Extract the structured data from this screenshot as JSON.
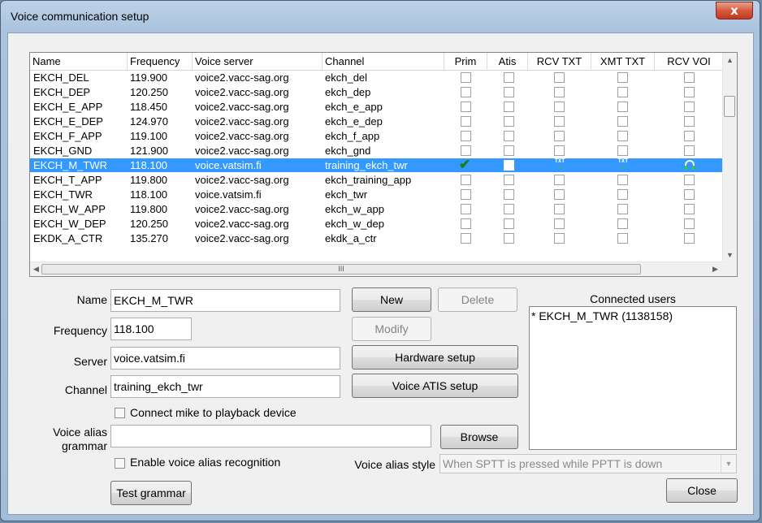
{
  "window": {
    "title": "Voice communication setup",
    "close_glyph": "x"
  },
  "grid": {
    "columns": [
      "Name",
      "Frequency",
      "Voice server",
      "Channel",
      "Prim",
      "Atis",
      "RCV TXT",
      "XMT TXT",
      "RCV VOI"
    ],
    "rows": [
      {
        "name": "EKCH_DEL",
        "freq": "119.900",
        "server": "voice2.vacc-sag.org",
        "channel": "ekch_del"
      },
      {
        "name": "EKCH_DEP",
        "freq": "120.250",
        "server": "voice2.vacc-sag.org",
        "channel": "ekch_dep"
      },
      {
        "name": "EKCH_E_APP",
        "freq": "118.450",
        "server": "voice2.vacc-sag.org",
        "channel": "ekch_e_app"
      },
      {
        "name": "EKCH_E_DEP",
        "freq": "124.970",
        "server": "voice2.vacc-sag.org",
        "channel": "ekch_e_dep"
      },
      {
        "name": "EKCH_F_APP",
        "freq": "119.100",
        "server": "voice2.vacc-sag.org",
        "channel": "ekch_f_app"
      },
      {
        "name": "EKCH_GND",
        "freq": "121.900",
        "server": "voice2.vacc-sag.org",
        "channel": "ekch_gnd"
      },
      {
        "name": "EKCH_M_TWR",
        "freq": "118.100",
        "server": "voice.vatsim.fi",
        "channel": "training_ekch_twr",
        "selected": true
      },
      {
        "name": "EKCH_T_APP",
        "freq": "119.800",
        "server": "voice2.vacc-sag.org",
        "channel": "ekch_training_app"
      },
      {
        "name": "EKCH_TWR",
        "freq": "118.100",
        "server": "voice.vatsim.fi",
        "channel": "ekch_twr"
      },
      {
        "name": "EKCH_W_APP",
        "freq": "119.800",
        "server": "voice2.vacc-sag.org",
        "channel": "ekch_w_app"
      },
      {
        "name": "EKCH_W_DEP",
        "freq": "120.250",
        "server": "voice2.vacc-sag.org",
        "channel": "ekch_w_dep"
      },
      {
        "name": "EKDK_A_CTR",
        "freq": "135.270",
        "server": "voice2.vacc-sag.org",
        "channel": "ekdk_a_ctr"
      }
    ],
    "icon_txt_label": "TXT",
    "hscroll_grip": "III"
  },
  "form": {
    "name_label": "Name",
    "name_value": "EKCH_M_TWR",
    "frequency_label": "Frequency",
    "frequency_value": "118.100",
    "server_label": "Server",
    "server_value": "voice.vatsim.fi",
    "channel_label": "Channel",
    "channel_value": "training_ekch_twr",
    "connect_mike_label": "Connect mike to playback device",
    "voice_alias_label_1": "Voice alias",
    "voice_alias_label_2": "grammar",
    "voice_alias_value": "",
    "enable_alias_label": "Enable voice alias recognition",
    "alias_style_label": "Voice alias style",
    "alias_style_value": "When SPTT is pressed while PPTT is down"
  },
  "buttons": {
    "new": "New",
    "delete": "Delete",
    "modify": "Modify",
    "hardware": "Hardware setup",
    "voice_atis": "Voice ATIS setup",
    "browse": "Browse",
    "test_grammar": "Test grammar",
    "close": "Close"
  },
  "users": {
    "title": "Connected users",
    "items": [
      "* EKCH_M_TWR (1138158)"
    ]
  },
  "colors": {
    "selection": "#3399ff",
    "check": "#1f7d1f"
  }
}
